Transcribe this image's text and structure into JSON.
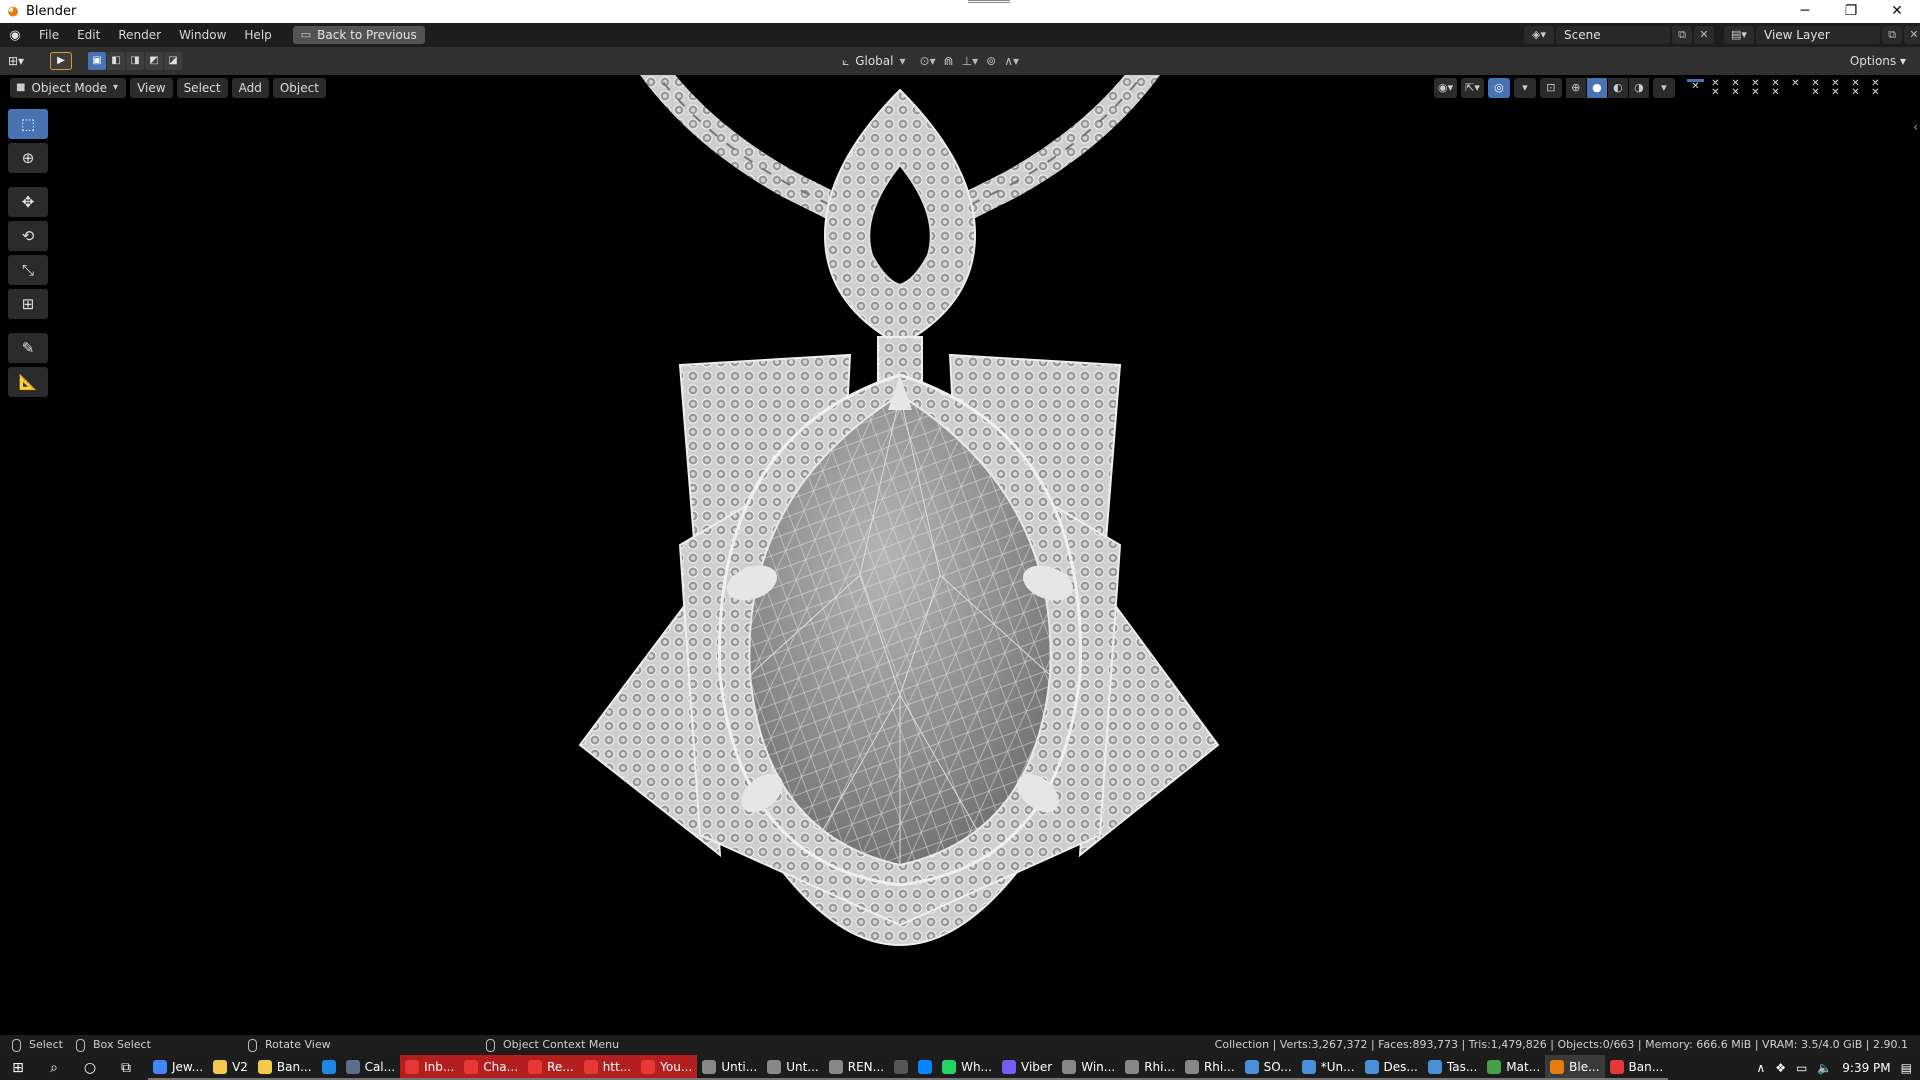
{
  "window": {
    "title": "Blender",
    "controls": [
      "minimize-icon",
      "restore-icon",
      "close-icon"
    ]
  },
  "menubar": {
    "items": [
      "File",
      "Edit",
      "Render",
      "Window",
      "Help"
    ],
    "back_button": "Back to Previous",
    "scene": "Scene",
    "view_layer": "View Layer"
  },
  "header": {
    "orientation": "Global",
    "options": "Options"
  },
  "viewport": {
    "mode": "Object Mode",
    "menus": [
      "View",
      "Select",
      "Add",
      "Object"
    ],
    "tools": [
      "select-box-icon",
      "cursor-icon",
      "move-icon",
      "rotate-icon",
      "scale-icon",
      "transform-icon",
      "annotate-icon",
      "measure-icon"
    ]
  },
  "statusbar": {
    "select": "Select",
    "box_select": "Box Select",
    "rotate_view": "Rotate View",
    "context_menu": "Object Context Menu",
    "stats": "Collection | Verts:3,267,372 | Faces:893,773 | Tris:1,479,826 | Objects:0/663 | Memory: 666.6 MiB | VRAM: 3.5/4.0 GiB | 2.90.1"
  },
  "taskbar": {
    "apps": [
      {
        "label": "Jew...",
        "color": "#4285f4",
        "icon": "chrome-icon"
      },
      {
        "label": "V2",
        "color": "#f2c94c",
        "icon": "folder-icon"
      },
      {
        "label": "Ban...",
        "color": "#f2c94c",
        "icon": "folder-icon"
      },
      {
        "label": "",
        "color": "#1e88e5",
        "icon": "mail-icon"
      },
      {
        "label": "Cal...",
        "color": "#5b6f8a",
        "icon": "calculator-icon"
      },
      {
        "label": "Inb...",
        "color": "#e53935",
        "icon": "opera-icon",
        "red": true
      },
      {
        "label": "Cha...",
        "color": "#e53935",
        "icon": "opera-icon",
        "red": true
      },
      {
        "label": "Re...",
        "color": "#e53935",
        "icon": "opera-icon",
        "red": true
      },
      {
        "label": "htt...",
        "color": "#e53935",
        "icon": "opera-icon",
        "red": true
      },
      {
        "label": "You...",
        "color": "#e53935",
        "icon": "opera-icon",
        "red": true
      },
      {
        "label": "Unti...",
        "color": "#888888",
        "icon": "rhino-icon"
      },
      {
        "label": "Unt...",
        "color": "#888888",
        "icon": "rhino-icon"
      },
      {
        "label": "REN...",
        "color": "#888888",
        "icon": "rhino-icon"
      },
      {
        "label": "",
        "color": "#555555",
        "icon": "obs-icon"
      },
      {
        "label": "",
        "color": "#0a84ff",
        "icon": "edge-icon"
      },
      {
        "label": "Wh...",
        "color": "#25d366",
        "icon": "whatsapp-icon"
      },
      {
        "label": "Viber",
        "color": "#7360f2",
        "icon": "viber-icon"
      },
      {
        "label": "Win...",
        "color": "#888888",
        "icon": "rhino-icon"
      },
      {
        "label": "Rhi...",
        "color": "#888888",
        "icon": "rhino-icon"
      },
      {
        "label": "Rhi...",
        "color": "#888888",
        "icon": "rhino-icon"
      },
      {
        "label": "SO...",
        "color": "#4a90d9",
        "icon": "notepad-icon"
      },
      {
        "label": "*Un...",
        "color": "#4a90d9",
        "icon": "notepad-icon"
      },
      {
        "label": "Des...",
        "color": "#4a90d9",
        "icon": "notepad-icon"
      },
      {
        "label": "Tas...",
        "color": "#4a90d9",
        "icon": "taskmanager-icon"
      },
      {
        "label": "Mat...",
        "color": "#43a047",
        "icon": "matrix-icon"
      },
      {
        "label": "Ble...",
        "color": "#e87d0d",
        "icon": "blender-icon",
        "active": true
      },
      {
        "label": "Ban...",
        "color": "#e53935",
        "icon": "record-icon"
      }
    ],
    "time": "9:39 PM"
  },
  "colors": {
    "accent_blue": "#4772b3",
    "active_tool_outline": "#d79b2b",
    "taskbar_red": "#b31e1e"
  }
}
